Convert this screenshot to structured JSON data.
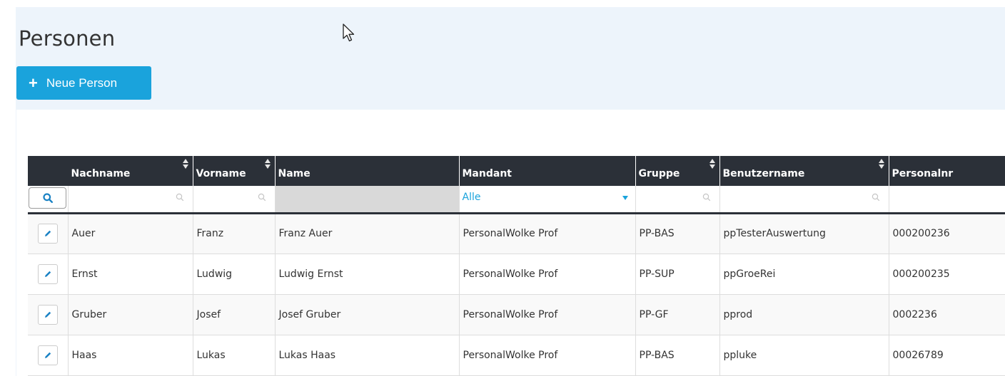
{
  "page": {
    "title": "Personen"
  },
  "toolbar": {
    "new_button_label": "Neue Person"
  },
  "table": {
    "columns": [
      "",
      "Nachname",
      "Vorname",
      "Name",
      "Mandant",
      "Gruppe",
      "Benutzername",
      "Personalnr"
    ],
    "filter": {
      "mandant_selected": "Alle"
    },
    "rows": [
      [
        "Auer",
        "Franz",
        "Franz Auer",
        "PersonalWolke Prof",
        "PP-BAS",
        "ppTesterAuswertung",
        "000200236"
      ],
      [
        "Ernst",
        "Ludwig",
        "Ludwig Ernst",
        "PersonalWolke Prof",
        "PP-SUP",
        "ppGroeRei",
        "000200235"
      ],
      [
        "Gruber",
        "Josef",
        "Josef Gruber",
        "PersonalWolke Prof",
        "PP-GF",
        "pprod",
        "0002236"
      ],
      [
        "Haas",
        "Lukas",
        "Lukas Haas",
        "PersonalWolke Prof",
        "PP-BAS",
        "ppluke",
        "00026789"
      ]
    ]
  },
  "colors": {
    "accent": "#1aa3dc",
    "header_bg": "#2b3038",
    "page_bg": "#edf4fb"
  },
  "icons": {
    "add": "plus-icon",
    "search": "search-icon",
    "edit": "pencil-icon",
    "sort": "sort-icon",
    "dropdown": "chevron-down-icon"
  }
}
